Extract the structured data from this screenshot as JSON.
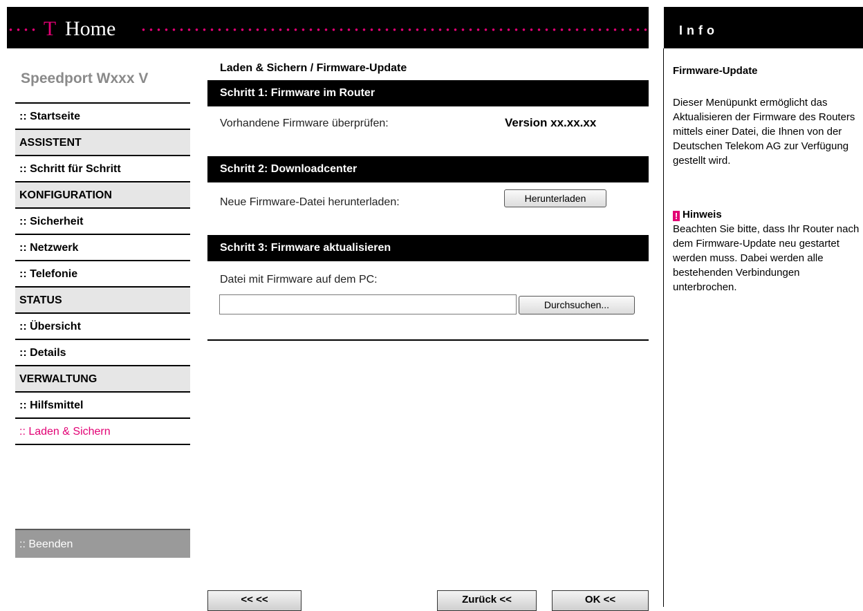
{
  "header": {
    "logo_glyph": "T",
    "title": "Home",
    "accent_color": "#e20074"
  },
  "info": {
    "title": "Info",
    "subtitle": "Firmware-Update",
    "description": "Dieser Menüpunkt ermöglicht das Aktualisieren der Firmware des Routers mittels einer Datei, die Ihnen von der Deutschen Telekom AG zur Verfügung gestellt wird.",
    "hinweis_icon": "!",
    "hinweis_title": "Hinweis",
    "hinweis_text": "Beachten Sie bitte, dass Ihr Router nach dem Firmware-Update neu gestartet werden muss. Dabei werden alle bestehenden Verbindungen unterbrochen."
  },
  "sidebar": {
    "product_name": "Speedport Wxxx V",
    "items": [
      {
        "label": ":: Startseite"
      },
      {
        "label": "ASSISTENT"
      },
      {
        "label": ":: Schritt für Schritt"
      },
      {
        "label": "KONFIGURATION"
      },
      {
        "label": ":: Sicherheit"
      },
      {
        "label": ":: Netzwerk"
      },
      {
        "label": ":: Telefonie"
      },
      {
        "label": "STATUS"
      },
      {
        "label": ":: Übersicht"
      },
      {
        "label": ":: Details"
      },
      {
        "label": "VERWALTUNG"
      },
      {
        "label": ":: Hilfsmittel"
      },
      {
        "label": ":: Laden & Sichern"
      }
    ],
    "exit_label": ":: Beenden"
  },
  "main": {
    "breadcrumb": "Laden & Sichern / Firmware-Update",
    "step1": {
      "title": "Schritt 1: Firmware im Router",
      "label": "Vorhandene Firmware überprüfen:",
      "version": "Version xx.xx.xx"
    },
    "step2": {
      "title": "Schritt 2: Downloadcenter",
      "label": "Neue Firmware-Datei herunterladen:",
      "button": "Herunterladen"
    },
    "step3": {
      "title": "Schritt 3: Firmware aktualisieren",
      "label": "Datei mit Firmware auf dem PC:",
      "file_value": "",
      "browse_button": "Durchsuchen..."
    },
    "nav": {
      "first": "<< <<",
      "back": "Zurück <<",
      "ok": "OK <<"
    }
  }
}
